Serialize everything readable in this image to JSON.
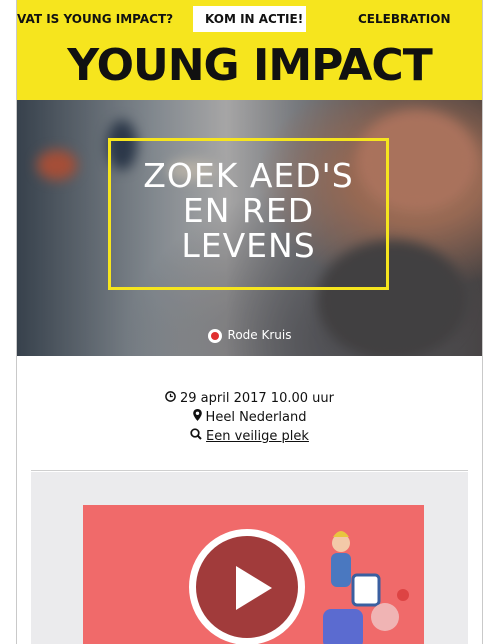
{
  "nav": {
    "items": [
      {
        "label": "VAT IS YOUNG IMPACT?"
      },
      {
        "label": "KOM IN ACTIE!"
      },
      {
        "label": "CELEBRATION"
      }
    ]
  },
  "brand": {
    "title": "YOUNG IMPACT"
  },
  "hero": {
    "title_line1": "ZOEK AED'S",
    "title_line2": "EN RED",
    "title_line3": "LEVENS",
    "organization": "Rode Kruis"
  },
  "event": {
    "date": "29 april 2017 10.00 uur",
    "location": "Heel Nederland",
    "place_link": "Een veilige plek"
  },
  "colors": {
    "brand_yellow": "#f6e51e",
    "video_bg": "#f06a6a",
    "play_button": "#a13b3b"
  },
  "icons": {
    "date": "clock-icon",
    "location": "map-pin-icon",
    "place": "search-icon",
    "video": "play-icon"
  }
}
